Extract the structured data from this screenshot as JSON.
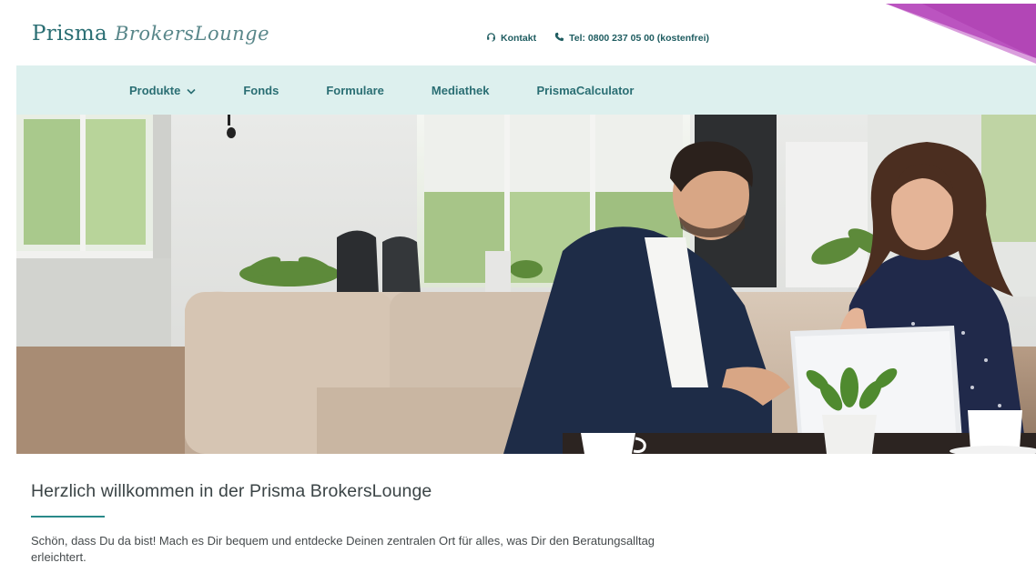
{
  "brand": {
    "name_main": "Prisma",
    "name_script": "BrokersLounge",
    "primary_color": "#2a6e73",
    "nav_bg_color": "#ddf0ee",
    "accent_color": "#b246b6"
  },
  "header": {
    "contact_label": "Kontakt",
    "phone_label": "Tel: 0800 237 05 00 (kostenfrei)"
  },
  "nav": {
    "items": [
      {
        "label": "Produkte",
        "has_dropdown": true
      },
      {
        "label": "Fonds"
      },
      {
        "label": "Formulare"
      },
      {
        "label": "Mediathek"
      },
      {
        "label": "PrismaCalculator"
      }
    ]
  },
  "hero": {
    "image_semantic": "hero-photo-two-people-laptop-office"
  },
  "main": {
    "headline": "Herzlich willkommen in der Prisma BrokersLounge",
    "intro": "Schön, dass Du da bist! Mach es Dir bequem und entdecke Deinen zentralen Ort für alles, was Dir den Beratungsalltag erleichtert."
  }
}
